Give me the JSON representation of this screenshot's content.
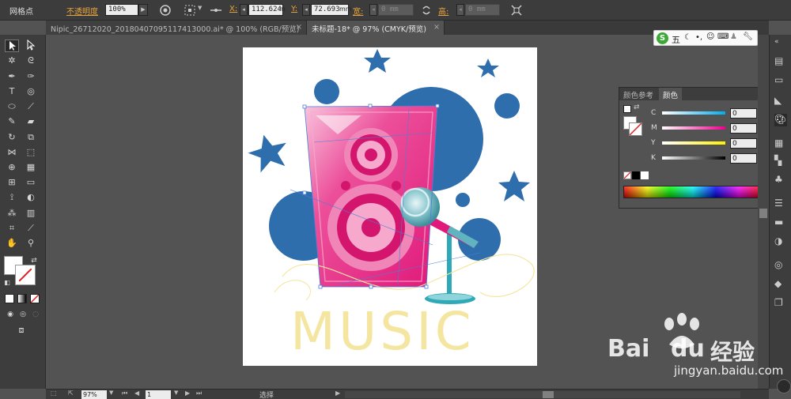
{
  "control_bar": {
    "selection_label": "网格点",
    "opacity_label": "不透明度",
    "opacity_value": "100%",
    "x_label": "X:",
    "x_value": "112.624",
    "x_unit": "m",
    "y_label": "Y:",
    "y_value": "72.693",
    "y_unit": "mm",
    "width_label": "宽:",
    "width_value": "0 mm",
    "height_label": "高:",
    "height_value": "0 mm"
  },
  "tabs": [
    {
      "label": "Nipic_26712020_20180407095117413000.ai* @ 100% (RGB/预览)",
      "close": "×"
    },
    {
      "label": "未标题-18* @ 97% (CMYK/预览)",
      "close": "×"
    }
  ],
  "artwork": {
    "text": "MUSIC",
    "colors": {
      "blue": "#2f6ead",
      "pink": "#e0197a",
      "yellow": "#f4e6a0",
      "teal": "#2fa9b8"
    }
  },
  "color_panel": {
    "tabs": [
      "颜色参考",
      "颜色"
    ],
    "active_tab": 1,
    "sliders": [
      {
        "label": "C",
        "value": "0",
        "unit": "%",
        "gradient": "linear-gradient(90deg,#fff,#00aeef)"
      },
      {
        "label": "M",
        "value": "0",
        "unit": "%",
        "gradient": "linear-gradient(90deg,#fff,#ec008c)"
      },
      {
        "label": "Y",
        "value": "0",
        "unit": "%",
        "gradient": "linear-gradient(90deg,#fff,#fff200)"
      },
      {
        "label": "K",
        "value": "0",
        "unit": "%",
        "gradient": "linear-gradient(90deg,#fff,#000)"
      }
    ]
  },
  "ime": {
    "label": "五"
  },
  "status_bar": {
    "zoom": "97%",
    "page": "1",
    "status": "选择"
  },
  "watermark": {
    "brand": "Bai",
    "brand2": "du",
    "suffix": "经验",
    "url": "jingyan.baidu.com"
  }
}
